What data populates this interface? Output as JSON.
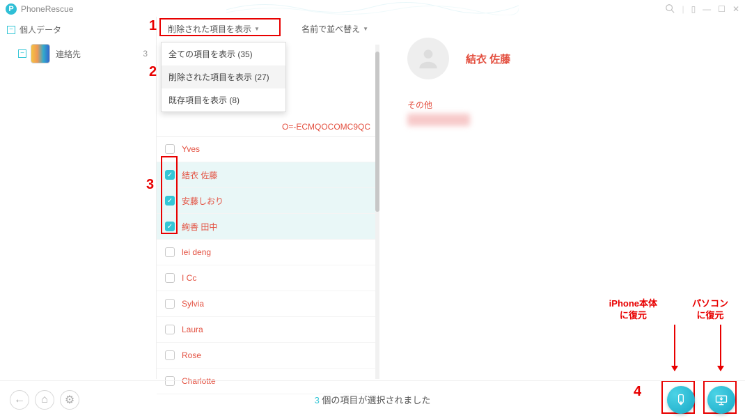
{
  "app": {
    "name": "PhoneRescue"
  },
  "sidebar": {
    "root": "個人データ",
    "item": {
      "label": "連絡先",
      "count": "3"
    }
  },
  "filter": {
    "current": "削除された項目を表示",
    "sort": "名前で並べ替え",
    "options": [
      "全ての項目を表示 (35)",
      "削除された項目を表示 (27)",
      "既存項目を表示 (8)"
    ]
  },
  "group_header": "O=-ECMQOCOMC9QC",
  "contacts": [
    {
      "name": "Yves",
      "checked": false
    },
    {
      "name": "結衣  佐藤",
      "checked": true
    },
    {
      "name": "安藤しおり",
      "checked": true
    },
    {
      "name": "絢香  田中",
      "checked": true
    },
    {
      "name": "lei  deng",
      "checked": false
    },
    {
      "name": "I  Cc",
      "checked": false
    },
    {
      "name": "Sylvia",
      "checked": false
    },
    {
      "name": "Laura",
      "checked": false
    },
    {
      "name": "Rose",
      "checked": false
    },
    {
      "name": "Charlotte",
      "checked": false
    }
  ],
  "detail": {
    "name": "結衣  佐藤",
    "section": "その他"
  },
  "status": {
    "count": "3",
    "suffix": " 個の項目が選択されました"
  },
  "annotation": {
    "n1": "1",
    "n2": "2",
    "n3": "3",
    "n4": "4",
    "to_device": "iPhone本体\nに復元",
    "to_pc": "パソコン\nに復元"
  }
}
